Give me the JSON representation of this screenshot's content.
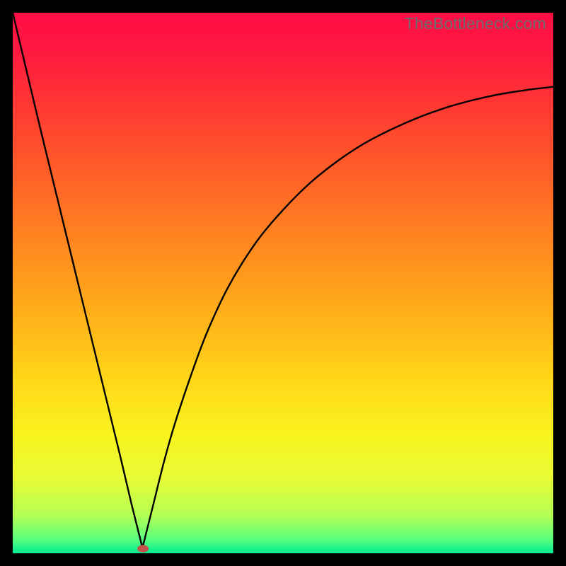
{
  "watermark": "TheBottleneck.com",
  "chart_data": {
    "type": "line",
    "title": "",
    "xlabel": "",
    "ylabel": "",
    "xlim": [
      0,
      100
    ],
    "ylim": [
      0,
      100
    ],
    "grid": false,
    "legend": false,
    "notch_x": 24,
    "series": [
      {
        "name": "curve",
        "x": [
          0,
          5,
          10,
          15,
          20,
          22,
          24,
          26,
          28,
          30,
          33,
          36,
          40,
          45,
          50,
          55,
          60,
          65,
          70,
          75,
          80,
          85,
          90,
          95,
          100
        ],
        "values": [
          100,
          79,
          58.5,
          38,
          17.5,
          9,
          1,
          9,
          17,
          24,
          33,
          41,
          49.5,
          57.5,
          63.5,
          68.5,
          72.5,
          75.8,
          78.4,
          80.6,
          82.4,
          83.8,
          84.9,
          85.7,
          86.3
        ]
      }
    ],
    "gradient_stops": [
      {
        "pos": 0.0,
        "color": "#ff0b45"
      },
      {
        "pos": 0.08,
        "color": "#ff1b3f"
      },
      {
        "pos": 0.18,
        "color": "#ff3a32"
      },
      {
        "pos": 0.3,
        "color": "#ff6028"
      },
      {
        "pos": 0.42,
        "color": "#ff8520"
      },
      {
        "pos": 0.55,
        "color": "#ffad1a"
      },
      {
        "pos": 0.68,
        "color": "#ffd718"
      },
      {
        "pos": 0.78,
        "color": "#f9f31e"
      },
      {
        "pos": 0.86,
        "color": "#e8fb36"
      },
      {
        "pos": 0.93,
        "color": "#b4ff54"
      },
      {
        "pos": 0.975,
        "color": "#57ff7e"
      },
      {
        "pos": 1.0,
        "color": "#00ea93"
      }
    ],
    "marker": {
      "x": 24.1,
      "y": 0.85,
      "rx": 8,
      "ry": 5.2,
      "color": "#c4544a"
    }
  }
}
